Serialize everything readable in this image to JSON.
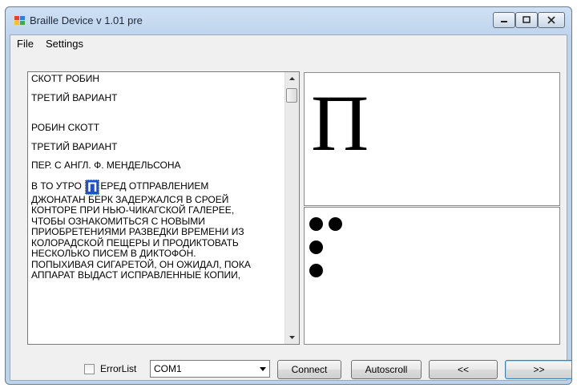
{
  "window": {
    "title": "Braille Device v 1.01 pre",
    "colors": {
      "frame": "#bcd3ec",
      "selection": "#1f4ed8"
    }
  },
  "title_controls": [
    "minimize-icon",
    "maximize-icon",
    "close-icon"
  ],
  "menu": {
    "file": "File",
    "settings": "Settings"
  },
  "text": {
    "lines_top": [
      "СКОТТ РОБИН",
      "ТРЕТИЙ ВАРИАНТ",
      "РОБИН СКОТТ",
      "ТРЕТИЙ ВАРИАНТ",
      "ПЕР. С АНГЛ. Ф. МЕНДЕЛЬСОНА"
    ],
    "para_before": "В ТО УТРО ",
    "highlight": "П",
    "para_after": "ЕРЕД ОТПРАВЛЕНИЕМ",
    "para_lines": [
      "ДЖОНАТАН БЕРК ЗАДЕРЖАЛСЯ В СРОЕЙ",
      "КОНТОРЕ ПРИ НЬЮ-ЧИКАГСКОЙ ГАЛЕРЕЕ,",
      "ЧТОБЫ ОЗНАКОМИТЬСЯ С НОВЫМИ",
      "ПРИОБРЕТЕНИЯМИ РАЗВЕДКИ ВРЕМЕНИ ИЗ",
      "КОЛОРАДСКОЙ ПЕЩЕРЫ И ПРОДИКТОВАТЬ",
      "НЕСКОЛЬКО ПИСЕМ В ДИКТОФОН.",
      "ПОПЫХИВАЯ СИГАРЕТОЙ, ОН ОЖИДАЛ, ПОКА",
      "АППАРАТ ВЫДАСТ ИСПРАВЛЕННЫЕ КОПИИ,"
    ]
  },
  "letter": {
    "current": "П"
  },
  "braille": {
    "raised_dots": [
      1,
      2,
      3,
      4
    ],
    "of_cells": 6
  },
  "bottom": {
    "errorlist_label": "ErrorList",
    "errorlist_checked": false,
    "port": "COM1",
    "connect": "Connect",
    "autoscroll": "Autoscroll",
    "prev": "<<",
    "next": ">>"
  }
}
